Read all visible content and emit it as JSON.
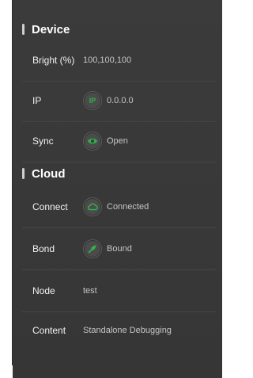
{
  "device": {
    "title": "Device",
    "bright": {
      "label": "Bright (%)",
      "value": "100,100,100"
    },
    "ip": {
      "label": "IP",
      "value": "0.0.0.0",
      "icon": "ip-icon",
      "icon_text": "IP"
    },
    "sync": {
      "label": "Sync",
      "value": "Open",
      "icon": "eye-icon"
    }
  },
  "cloud": {
    "title": "Cloud",
    "connect": {
      "label": "Connect",
      "value": "Connected",
      "icon": "cloud-icon"
    },
    "bond": {
      "label": "Bond",
      "value": "Bound",
      "icon": "link-icon"
    },
    "node": {
      "label": "Node",
      "value": "test"
    },
    "content": {
      "label": "Content",
      "value": "Standalone Debugging"
    }
  },
  "colors": {
    "panel_bg": "#3a3a3a",
    "accent_green": "#2fb34a",
    "label_text": "#f2f2f2",
    "value_text": "#c5c5c5"
  }
}
